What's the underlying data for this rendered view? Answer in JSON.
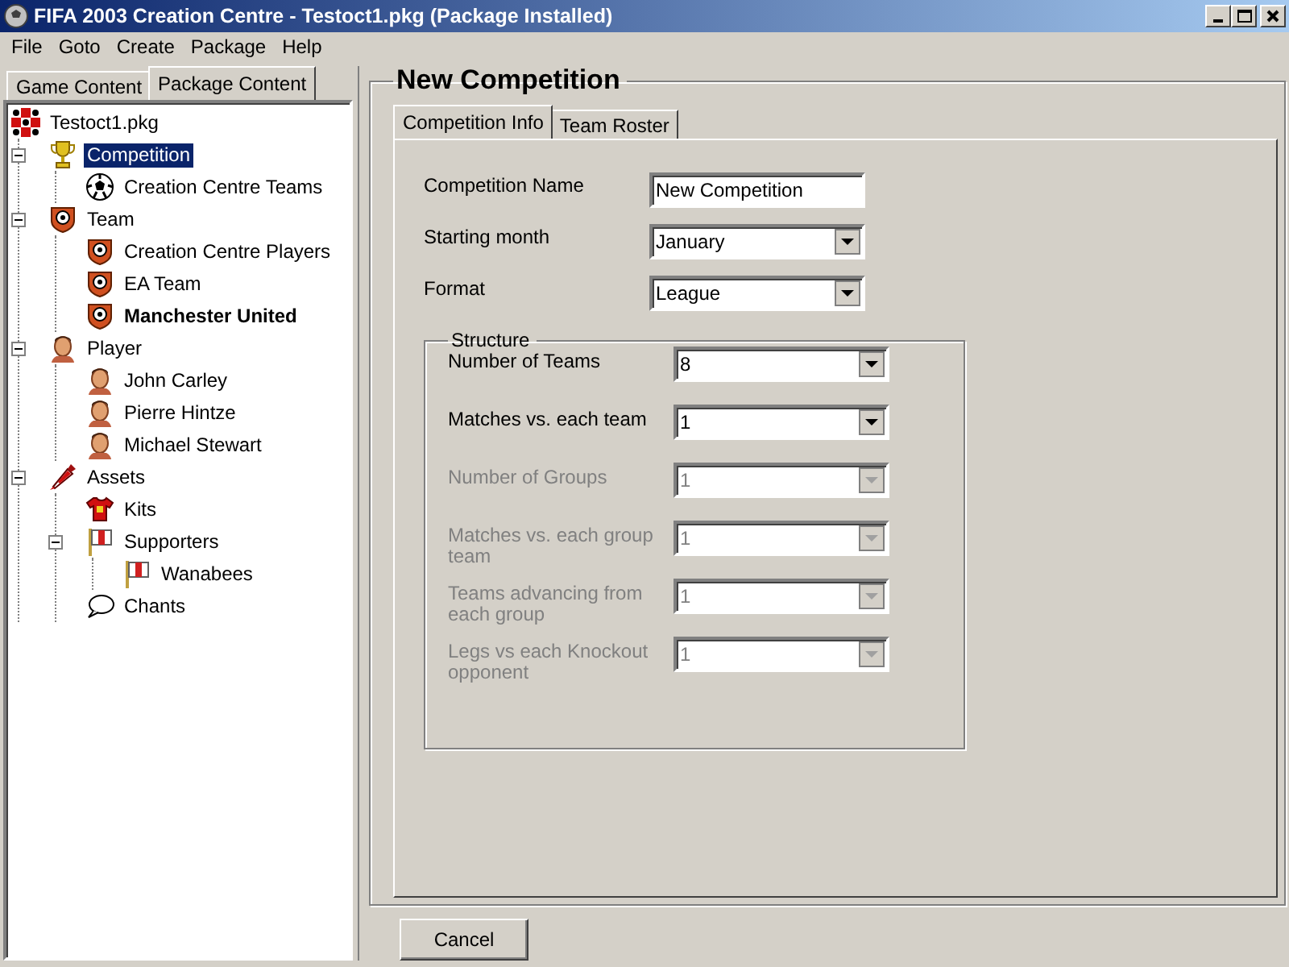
{
  "window": {
    "title": "FIFA 2003 Creation Centre - Testoct1.pkg (Package Installed)"
  },
  "menu": [
    "File",
    "Goto",
    "Create",
    "Package",
    "Help"
  ],
  "left_tabs": [
    {
      "label": "Game Content",
      "selected": false
    },
    {
      "label": "Package Content",
      "selected": true
    }
  ],
  "tree": {
    "root": {
      "label": "Testoct1.pkg",
      "kind": "package"
    },
    "items": [
      {
        "label": "Competition",
        "kind": "trophy",
        "expanded": true,
        "selected": true,
        "bold": false,
        "children": [
          {
            "label": "Creation Centre Teams",
            "kind": "ball",
            "selected": false,
            "bold": false
          }
        ]
      },
      {
        "label": "Team",
        "kind": "shield",
        "expanded": true,
        "selected": false,
        "bold": false,
        "children": [
          {
            "label": "Creation Centre Players",
            "kind": "shield",
            "selected": false,
            "bold": false
          },
          {
            "label": "EA Team",
            "kind": "shield",
            "selected": false,
            "bold": false
          },
          {
            "label": "Manchester United",
            "kind": "shield",
            "selected": false,
            "bold": true
          }
        ]
      },
      {
        "label": "Player",
        "kind": "head",
        "expanded": true,
        "selected": false,
        "bold": false,
        "children": [
          {
            "label": "John Carley",
            "kind": "head",
            "selected": false,
            "bold": false
          },
          {
            "label": "Pierre Hintze",
            "kind": "head",
            "selected": false,
            "bold": false
          },
          {
            "label": "Michael Stewart",
            "kind": "head",
            "selected": false,
            "bold": false
          }
        ]
      },
      {
        "label": "Assets",
        "kind": "marker",
        "expanded": true,
        "selected": false,
        "bold": false,
        "children": [
          {
            "label": "Kits",
            "kind": "shirt",
            "selected": false,
            "bold": false
          },
          {
            "label": "Supporters",
            "kind": "flag",
            "expanded": true,
            "selected": false,
            "bold": false,
            "children": [
              {
                "label": "Wanabees",
                "kind": "flag",
                "selected": false,
                "bold": false
              }
            ]
          },
          {
            "label": "Chants",
            "kind": "speech",
            "selected": false,
            "bold": false
          }
        ]
      }
    ]
  },
  "panel": {
    "title": "New Competition",
    "tabs": [
      {
        "label": "Competition Info",
        "selected": true
      },
      {
        "label": "Team Roster",
        "selected": false
      }
    ],
    "fields": [
      {
        "label": "Competition Name",
        "kind": "text",
        "value": "New Competition"
      },
      {
        "label": "Starting month",
        "kind": "select",
        "value": "January"
      },
      {
        "label": "Format",
        "kind": "select",
        "value": "League"
      }
    ],
    "structure": {
      "title": "Structure",
      "fields": [
        {
          "label": "Number of Teams",
          "value": "8",
          "disabled": false
        },
        {
          "label": "Matches vs. each team",
          "value": "1",
          "disabled": false
        },
        {
          "label": "Number of Groups",
          "value": "1",
          "disabled": true
        },
        {
          "label": "Matches vs. each group team",
          "value": "1",
          "disabled": true
        },
        {
          "label": "Teams advancing from each group",
          "value": "1",
          "disabled": true
        },
        {
          "label": "Legs vs each Knockout opponent",
          "value": "1",
          "disabled": true
        }
      ]
    }
  },
  "buttons": [
    "Cancel"
  ]
}
